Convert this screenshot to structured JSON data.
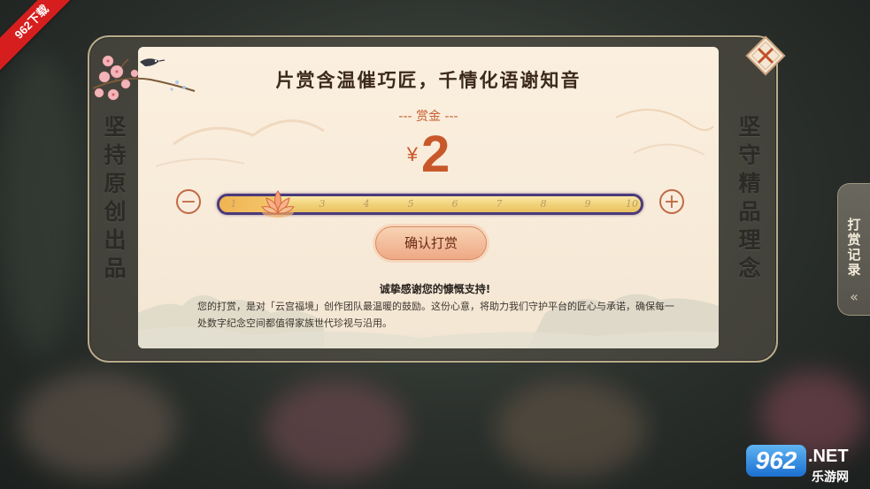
{
  "watermark_corner": "962下载",
  "panel": {
    "title": "片赏含温催巧匠，千情化语谢知音",
    "reward_label": "--- 赏金 ---",
    "currency_symbol": "¥",
    "amount": "2",
    "left_vertical_text": "坚持原创出品",
    "right_vertical_text": "坚守精品理念"
  },
  "slider": {
    "minus_label": "−",
    "plus_label": "+",
    "ticks": [
      "1",
      "2",
      "3",
      "4",
      "5",
      "6",
      "7",
      "8",
      "9",
      "10"
    ],
    "selected_value": 2,
    "min": 1,
    "max": 10
  },
  "confirm_button": "确认打赏",
  "thanks": {
    "title": "诚挚感谢您的慷慨支持!",
    "body": "您的打赏，是对「云宫福境」创作团队最温暖的鼓励。这份心意，将助力我们守护平台的匠心与承诺，确保每一处数字纪念空间都值得家族世代珍视与沿用。"
  },
  "record_tab": {
    "label": "打赏记录",
    "chevron": "«"
  },
  "watermark_logo": {
    "brand": "962",
    "suffix": ".NET",
    "subtitle": "乐游网"
  },
  "colors": {
    "accent": "#c8582a",
    "title": "#3b2a1c",
    "parchment": "#f8ebd9",
    "slider_border": "#4a3a7a"
  },
  "icons": {
    "close": "close-icon",
    "thumb": "lotus-icon",
    "corner_art": "plum-blossom-bird-art"
  }
}
